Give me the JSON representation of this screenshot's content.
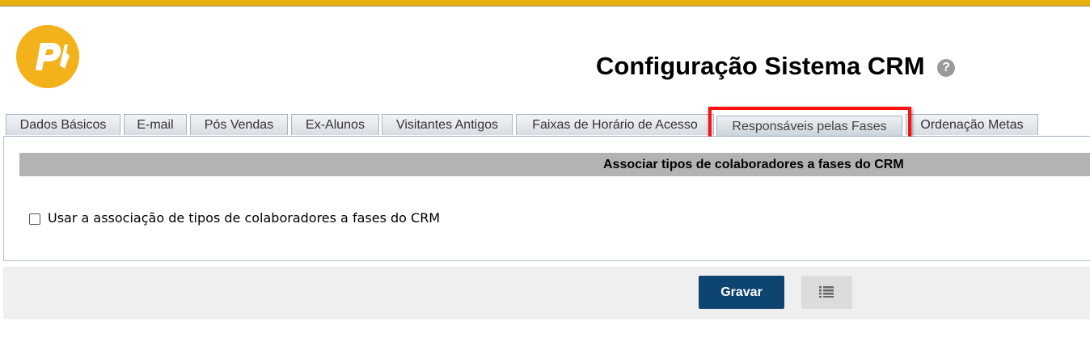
{
  "header": {
    "title": "Configuração Sistema CRM",
    "help_icon": "help-icon",
    "logo_icon": "pacto-logo"
  },
  "tabs": [
    {
      "label": "Dados Básicos",
      "active": false
    },
    {
      "label": "E-mail",
      "active": false
    },
    {
      "label": "Pós Vendas",
      "active": false
    },
    {
      "label": "Ex-Alunos",
      "active": false
    },
    {
      "label": "Visitantes Antigos",
      "active": false
    },
    {
      "label": "Faixas de Horário de Acesso",
      "active": false
    },
    {
      "label": "Responsáveis pelas Fases",
      "active": true
    },
    {
      "label": "Ordenação Metas",
      "active": false
    }
  ],
  "section": {
    "title": "Associar tipos de colaboradores a fases do CRM",
    "checkbox_label": "Usar a associação de tipos de colaboradores a fases do CRM",
    "checkbox_checked": false
  },
  "footer": {
    "save_label": "Gravar",
    "list_icon": "list-icon"
  },
  "colors": {
    "top_bar": "#e8b011",
    "highlight": "#ff1010",
    "save_button": "#0e4470",
    "section_header": "#b3b3b3"
  }
}
